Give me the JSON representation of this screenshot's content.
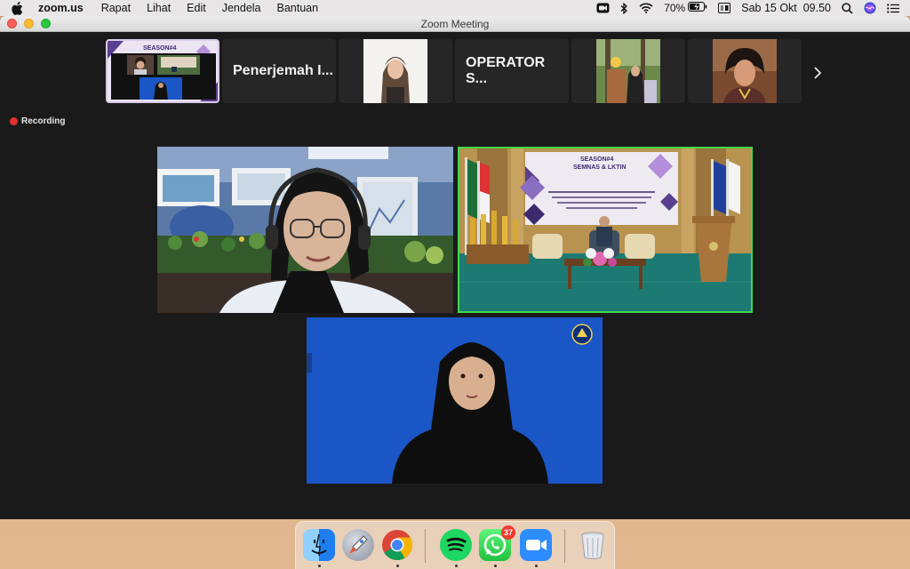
{
  "menubar": {
    "app_name": "zoom.us",
    "menus": [
      "Rapat",
      "Lihat",
      "Edit",
      "Jendela",
      "Bantuan"
    ],
    "battery": "70%",
    "datetime": "Sab 15 Okt  09.50"
  },
  "window": {
    "title": "Zoom Meeting",
    "recording_label": "Recording"
  },
  "strip": {
    "name_tiles": [
      "Penerjemah I...",
      "OPERATOR S..."
    ],
    "mini_banner": "SEASON#4"
  },
  "venue": {
    "banner_line1": "SEASON#4",
    "banner_line2": "SEMNAS & LKTIN"
  },
  "dock": {
    "whatsapp_badge": "37"
  },
  "colors": {
    "active_speaker_border": "#3fd94a",
    "recording_dot": "#e4302f",
    "interpreter_bg": "#1a56c6",
    "window_bg": "#1a1a1a"
  }
}
